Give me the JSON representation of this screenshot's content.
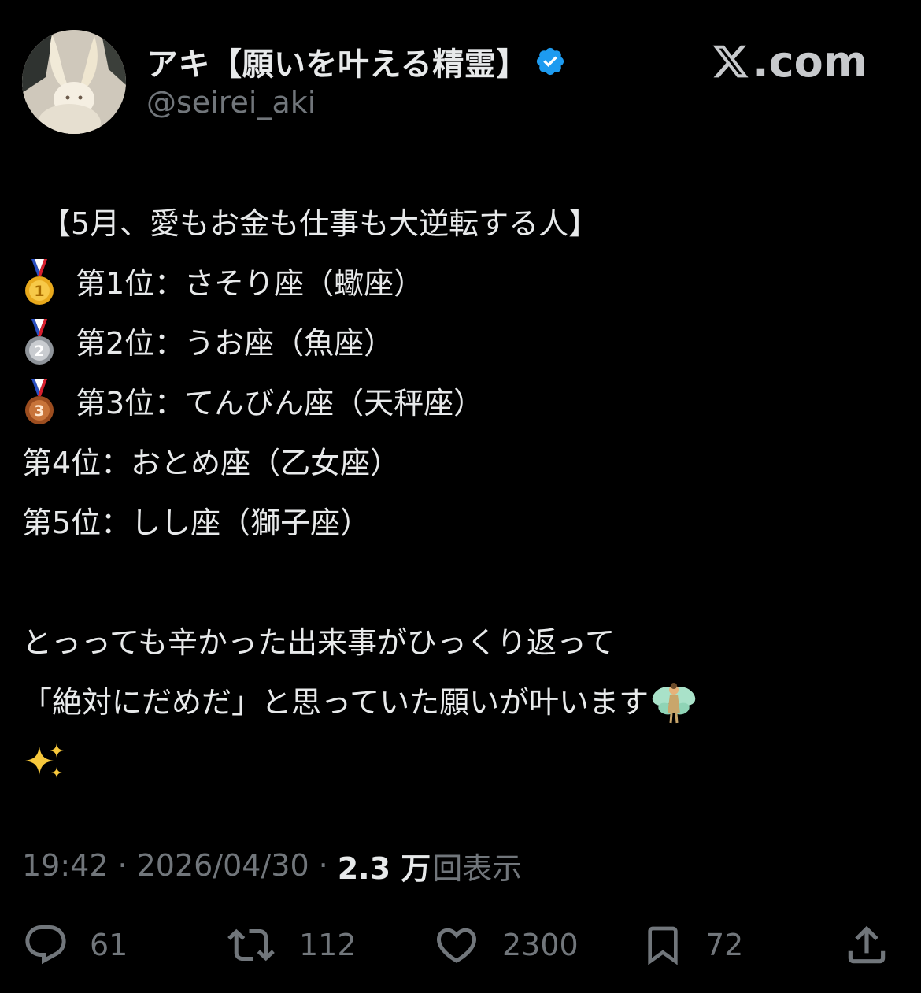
{
  "author": {
    "display_name": "アキ【願いを叶える精霊】",
    "handle": "@seirei_aki",
    "verified": true,
    "avatar_icon": "fairy-avatar-icon"
  },
  "brand": {
    "label": ".com",
    "icon": "x-logo-icon"
  },
  "tweet": {
    "title": "【5月、愛もお金も仕事も大逆転する人】",
    "rankings": [
      {
        "medal_icon": "gold-medal-icon",
        "text": "第1位：さそり座（蠍座）"
      },
      {
        "medal_icon": "silver-medal-icon",
        "text": "第2位：うお座（魚座）"
      },
      {
        "medal_icon": "bronze-medal-icon",
        "text": "第3位：てんびん座（天秤座）"
      },
      {
        "medal_icon": "",
        "text": "第4位：おとめ座（乙女座）"
      },
      {
        "medal_icon": "",
        "text": "第5位：しし座（獅子座）"
      }
    ],
    "paragraph_line_1": "とっっても辛かった出来事がひっくり返って",
    "paragraph_line_2": "「絶対にだめだ」と思っていた願いが叶います",
    "emoji_1": "fairy-emoji-icon",
    "emoji_2": "sparkles-emoji-icon"
  },
  "meta": {
    "time": "19:42",
    "separator": "·",
    "date": "2026/04/30",
    "views_count": "2.3 万",
    "views_label": "回表示"
  },
  "actions": {
    "replies": "61",
    "reposts": "112",
    "likes": "2300",
    "bookmarks": "72"
  },
  "colors": {
    "background": "#000000",
    "text_primary": "#e7e9ea",
    "text_secondary": "#71767b",
    "verified_blue": "#1d9bf0"
  }
}
